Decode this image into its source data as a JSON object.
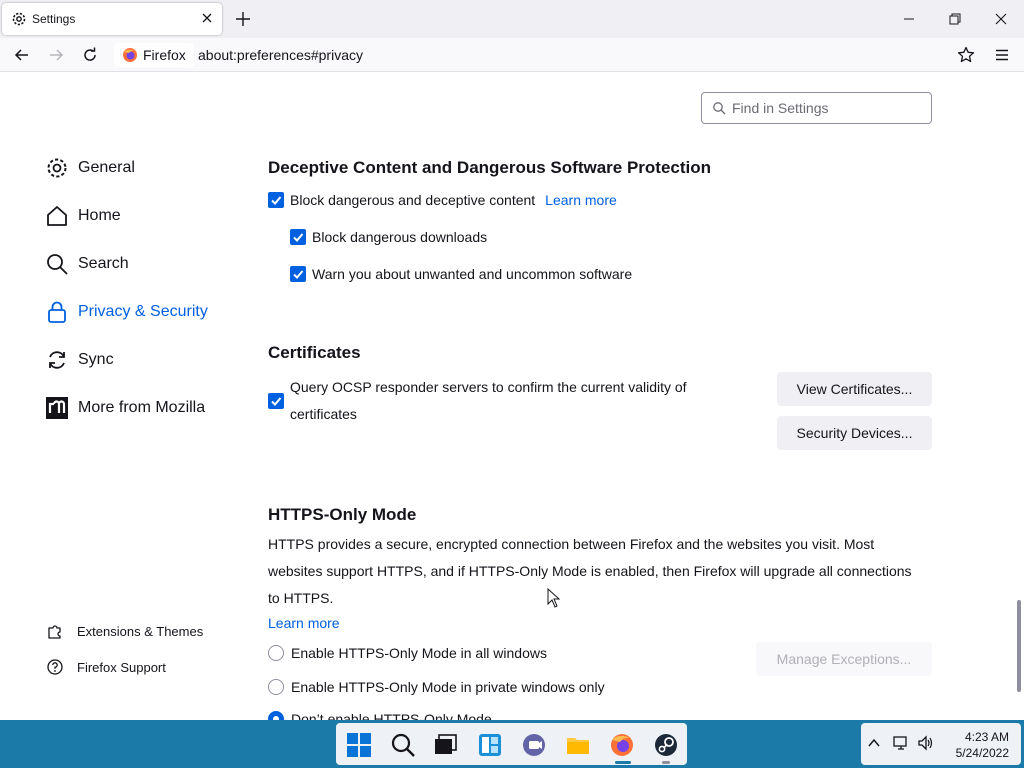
{
  "browser": {
    "tab_title": "Settings",
    "url_identity": "Firefox",
    "url": "about:preferences#privacy"
  },
  "search": {
    "placeholder": "Find in Settings"
  },
  "sidebar": {
    "categories": [
      {
        "label": "General"
      },
      {
        "label": "Home"
      },
      {
        "label": "Search"
      },
      {
        "label": "Privacy & Security",
        "active": true
      },
      {
        "label": "Sync"
      },
      {
        "label": "More from Mozilla"
      }
    ],
    "footer": [
      {
        "label": "Extensions & Themes"
      },
      {
        "label": "Firefox Support"
      }
    ]
  },
  "deceptive": {
    "heading": "Deceptive Content and Dangerous Software Protection",
    "block_label": "Block dangerous and deceptive content",
    "learn_more": "Learn more",
    "downloads_label": "Block dangerous downloads",
    "unwanted_label": "Warn you about unwanted and uncommon software"
  },
  "certificates": {
    "heading": "Certificates",
    "ocsp_label": "Query OCSP responder servers to confirm the current validity of certificates",
    "view_button": "View Certificates...",
    "devices_button": "Security Devices..."
  },
  "https_only": {
    "heading": "HTTPS-Only Mode",
    "description": "HTTPS provides a secure, encrypted connection between Firefox and the websites you visit. Most websites support HTTPS, and if HTTPS-Only Mode is enabled, then Firefox will upgrade all connections to HTTPS.",
    "learn_more": "Learn more",
    "option_all": "Enable HTTPS-Only Mode in all windows",
    "option_private": "Enable HTTPS-Only Mode in private windows only",
    "option_off": "Don’t enable HTTPS-Only Mode",
    "manage_button": "Manage Exceptions..."
  },
  "taskbar": {
    "time": "4:23 AM",
    "date": "5/24/2022"
  },
  "colors": {
    "accent": "#0061e0",
    "taskbar": "#1b7aa8"
  }
}
